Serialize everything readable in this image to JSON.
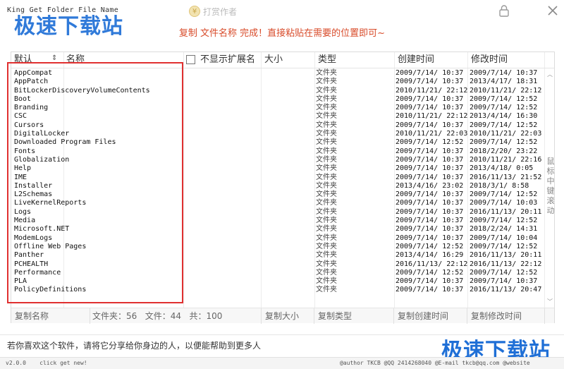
{
  "window": {
    "title": "King Get Folder File Name",
    "watermark": "极速下载站",
    "donate_label": "打赏作者"
  },
  "notice": "复制 文件名称 完成！直接粘贴在需要的位置即可~",
  "columns": {
    "default": "默认",
    "name": "名称",
    "hide_ext": "不显示扩展名",
    "size": "大小",
    "type": "类型",
    "created": "创建时间",
    "modified": "修改时间"
  },
  "rows": [
    {
      "name": "AppCompat",
      "type": "文件夹",
      "created": "2009/7/14/ 10:37",
      "modified": "2009/7/14/ 10:37"
    },
    {
      "name": "AppPatch",
      "type": "文件夹",
      "created": "2009/7/14/ 10:37",
      "modified": "2013/4/17/ 18:31"
    },
    {
      "name": "BitLockerDiscoveryVolumeContents",
      "type": "文件夹",
      "created": "2010/11/21/ 22:12",
      "modified": "2010/11/21/ 22:12"
    },
    {
      "name": "Boot",
      "type": "文件夹",
      "created": "2009/7/14/ 10:37",
      "modified": "2009/7/14/ 12:52"
    },
    {
      "name": "Branding",
      "type": "文件夹",
      "created": "2009/7/14/ 10:37",
      "modified": "2009/7/14/ 12:52"
    },
    {
      "name": "CSC",
      "type": "文件夹",
      "created": "2010/11/21/ 22:12",
      "modified": "2013/4/14/ 16:30"
    },
    {
      "name": "Cursors",
      "type": "文件夹",
      "created": "2009/7/14/ 10:37",
      "modified": "2009/7/14/ 12:52"
    },
    {
      "name": "DigitalLocker",
      "type": "文件夹",
      "created": "2010/11/21/ 22:03",
      "modified": "2010/11/21/ 22:03"
    },
    {
      "name": "Downloaded Program Files",
      "type": "文件夹",
      "created": "2009/7/14/ 12:52",
      "modified": "2009/7/14/ 12:52"
    },
    {
      "name": "Fonts",
      "type": "文件夹",
      "created": "2009/7/14/ 10:37",
      "modified": "2018/2/20/ 23:22"
    },
    {
      "name": "Globalization",
      "type": "文件夹",
      "created": "2009/7/14/ 10:37",
      "modified": "2010/11/21/ 22:16"
    },
    {
      "name": "Help",
      "type": "文件夹",
      "created": "2009/7/14/ 10:37",
      "modified": "2013/4/18/ 0:05"
    },
    {
      "name": "IME",
      "type": "文件夹",
      "created": "2009/7/14/ 10:37",
      "modified": "2016/11/13/ 21:52"
    },
    {
      "name": "Installer",
      "type": "文件夹",
      "created": "2013/4/16/ 23:02",
      "modified": "2018/3/1/ 8:58"
    },
    {
      "name": "L2Schemas",
      "type": "文件夹",
      "created": "2009/7/14/ 10:37",
      "modified": "2009/7/14/ 12:52"
    },
    {
      "name": "LiveKernelReports",
      "type": "文件夹",
      "created": "2009/7/14/ 10:37",
      "modified": "2009/7/14/ 10:03"
    },
    {
      "name": "Logs",
      "type": "文件夹",
      "created": "2009/7/14/ 10:37",
      "modified": "2016/11/13/ 20:11"
    },
    {
      "name": "Media",
      "type": "文件夹",
      "created": "2009/7/14/ 10:37",
      "modified": "2009/7/14/ 12:52"
    },
    {
      "name": "Microsoft.NET",
      "type": "文件夹",
      "created": "2009/7/14/ 10:37",
      "modified": "2018/2/24/ 14:31"
    },
    {
      "name": "ModemLogs",
      "type": "文件夹",
      "created": "2009/7/14/ 10:37",
      "modified": "2009/7/14/ 10:04"
    },
    {
      "name": "Offline Web Pages",
      "type": "文件夹",
      "created": "2009/7/14/ 12:52",
      "modified": "2009/7/14/ 12:52"
    },
    {
      "name": "Panther",
      "type": "文件夹",
      "created": "2013/4/14/ 16:29",
      "modified": "2016/11/13/ 20:11"
    },
    {
      "name": "PCHEALTH",
      "type": "文件夹",
      "created": "2016/11/13/ 22:12",
      "modified": "2016/11/13/ 22:12"
    },
    {
      "name": "Performance",
      "type": "文件夹",
      "created": "2009/7/14/ 12:52",
      "modified": "2009/7/14/ 12:52"
    },
    {
      "name": "PLA",
      "type": "文件夹",
      "created": "2009/7/14/ 10:37",
      "modified": "2009/7/14/ 10:37"
    },
    {
      "name": "PolicyDefinitions",
      "type": "文件夹",
      "created": "2009/7/14/ 10:37",
      "modified": "2016/11/13/ 20:47"
    }
  ],
  "scroll_hint": "鼠标中键滚动",
  "footer": {
    "copy_name": "复制名称",
    "folders_label": "文件夹：",
    "folders_count": "56",
    "files_label": "文件：",
    "files_count": "44",
    "total_label": "共：",
    "total_count": "100",
    "copy_size": "复制大小",
    "copy_type": "复制类型",
    "copy_created": "复制创建时间",
    "copy_modified": "复制修改时间"
  },
  "share_text": "若你喜欢这个软件，请将它分享给你身边的人，以便能帮助到更多人",
  "status": {
    "version": "v2.0.0",
    "click": "click get new!",
    "credits": "@author TKCB  @QQ 2414268040  @E-mail tkcb@qq.com  @website www.tkcb.cc"
  },
  "colors": {
    "accent_red": "#d84b2a",
    "watermark_blue": "#1f6fd6",
    "highlight_box": "#e03030"
  }
}
